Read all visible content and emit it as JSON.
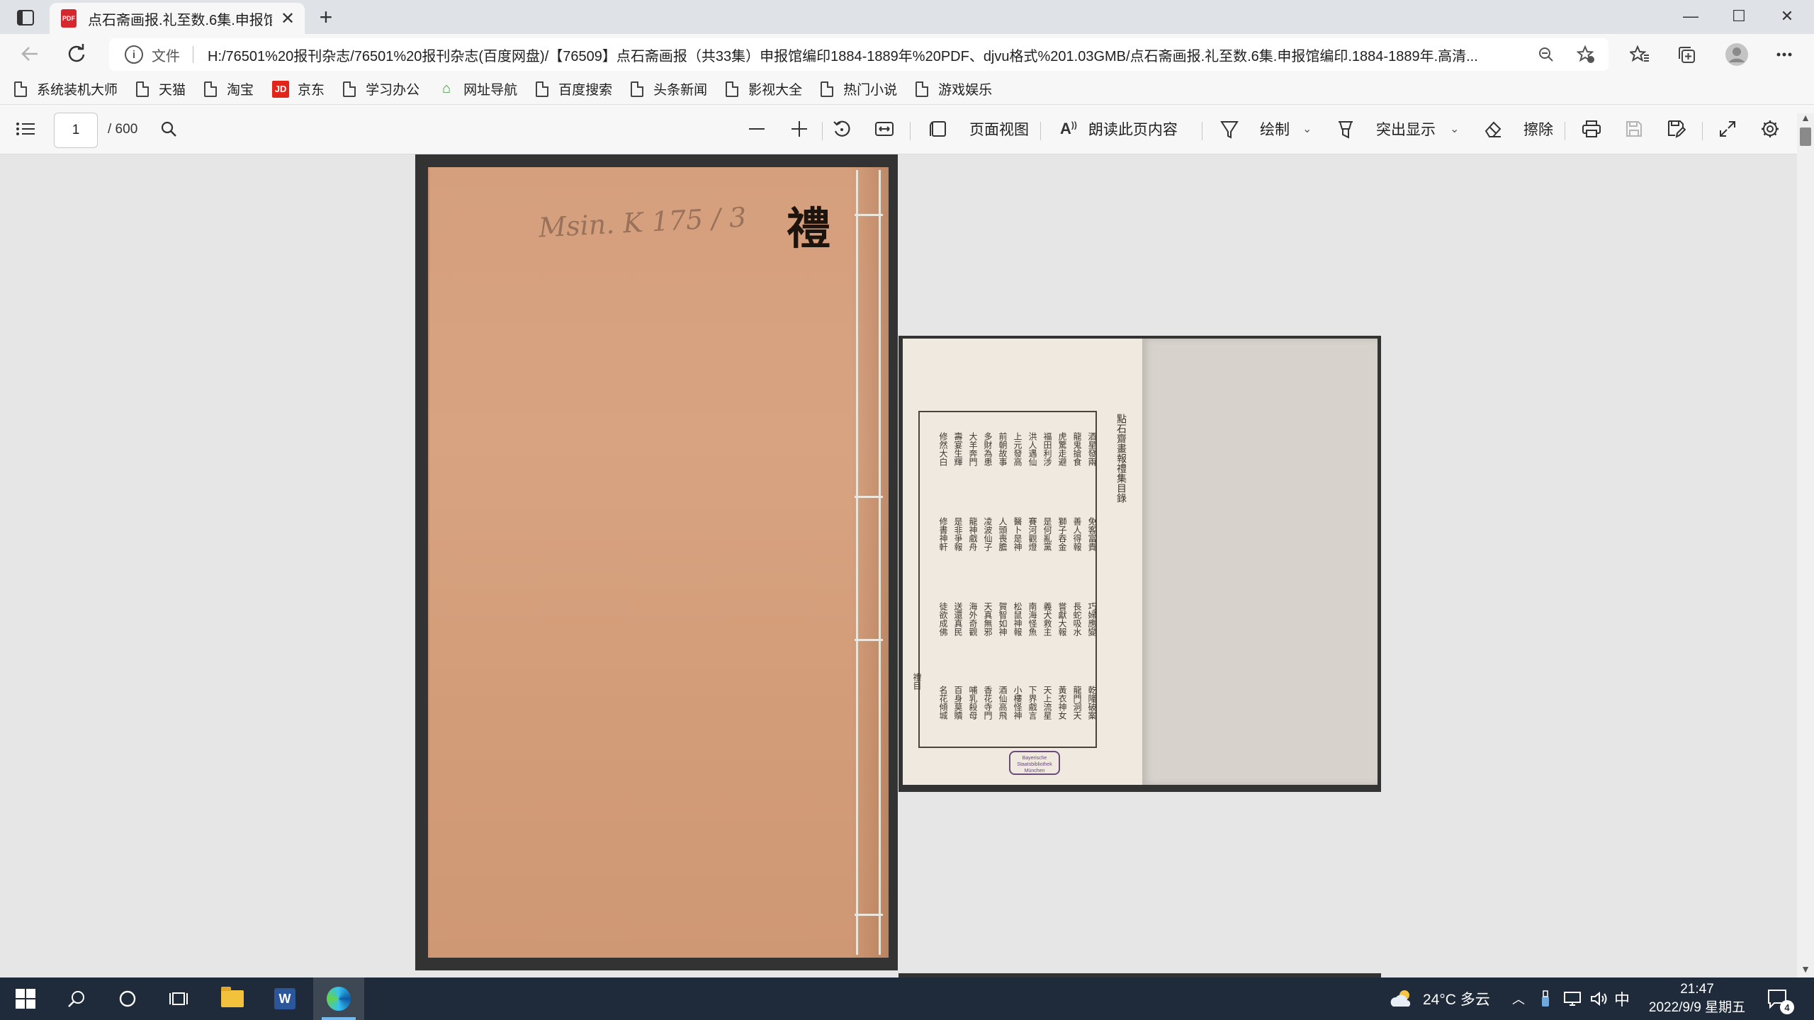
{
  "tab": {
    "favicon": "PDF",
    "title": "点石斋画报.礼至数.6集.申报馆编",
    "close": "✕",
    "new_tab": "+"
  },
  "window": {
    "minimize": "—",
    "maximize": "☐",
    "close": "✕"
  },
  "address": {
    "scheme_label": "文件",
    "url": "H:/76501%20报刊杂志/76501%20报刊杂志(百度网盘)/【76509】点石斋画报（共33集）申报馆编印1884-1889年%20PDF、djvu格式%201.03GMB/点石斋画报.礼至数.6集.申报馆编印.1884-1889年.高清..."
  },
  "favorites": [
    {
      "label": "系统装机大师",
      "icon": "page-icon"
    },
    {
      "label": "天猫",
      "icon": "page-icon"
    },
    {
      "label": "淘宝",
      "icon": "page-icon"
    },
    {
      "label": "京东",
      "icon": "jd-icon",
      "icon_text": "JD"
    },
    {
      "label": "学习办公",
      "icon": "page-icon"
    },
    {
      "label": "网址导航",
      "icon": "nav-icon"
    },
    {
      "label": "百度搜索",
      "icon": "page-icon"
    },
    {
      "label": "头条新闻",
      "icon": "page-icon"
    },
    {
      "label": "影视大全",
      "icon": "page-icon"
    },
    {
      "label": "热门小说",
      "icon": "page-icon"
    },
    {
      "label": "游戏娱乐",
      "icon": "page-icon"
    }
  ],
  "pdf_toolbar": {
    "current_page": "1",
    "total_pages": "/ 600",
    "page_view": "页面视图",
    "read_aloud": "朗读此页内容",
    "draw": "绘制",
    "highlight": "突出显示",
    "erase": "擦除"
  },
  "document": {
    "cover_title": "禮",
    "cover_note": "Msin. K 175 / 3",
    "toc_heading": "點石齋畫報禮集目錄",
    "toc_columns": [
      "酒星發兩",
      "龍鬼搶食",
      "虎驚走避",
      "福田利涉",
      "洪人遇仙",
      "上元發高",
      "前朝故事",
      "多財為患",
      "大羊奔門",
      "壽宴生輝",
      "修然大白",
      "免客富貴",
      "善人得報",
      "獅子吞金",
      "是何亂黨",
      "賽河觀燈",
      "醫卜是神",
      "人頭喪膽",
      "凌波仙子",
      "龍神戲舟",
      "是非爭報",
      "修書神軒",
      "巧婦應變",
      "長蛇吸水",
      "嘗獻大報",
      "義犬救主",
      "南海怪魚",
      "松鼠神報",
      "賀智如神",
      "天真無邪",
      "海外奇觀",
      "送還真民",
      "徒欲成佛",
      "乾隆破案",
      "龍門洞天",
      "黃衣神女",
      "天上流星",
      "下界戲言",
      "小樓怪神",
      "酒仙高飛",
      "香花寺門",
      "哺乳殺母",
      "百身莫贖",
      "名花傾城"
    ],
    "toc_side": "禮目",
    "stamp": "Bayerische Staatsbibliothek München"
  },
  "taskbar": {
    "weather": "24°C 多云",
    "ime": "中",
    "time": "21:47",
    "date": "2022/9/9 星期五",
    "notifications": "4"
  }
}
